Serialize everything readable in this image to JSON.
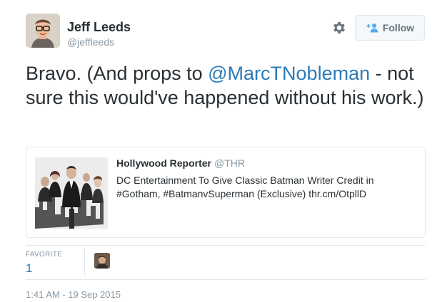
{
  "author": {
    "name": "Jeff Leeds",
    "handle": "@jeffleeds"
  },
  "header": {
    "follow_label": "Follow"
  },
  "tweet": {
    "text_part1": "Bravo. (And props to ",
    "mention": "@MarcTNobleman",
    "text_part2": " - not sure this would've happened without his work.)"
  },
  "card": {
    "source_name": "Hollywood Reporter",
    "source_handle": "@THR",
    "text": "DC Entertainment To Give Classic Batman Writer Credit in #Gotham, #BatmanvSuperman (Exclusive) thr.cm/OtpllD"
  },
  "stats": {
    "favorite_label": "FAVORITE",
    "favorite_count": "1"
  },
  "timestamp": "1:41 AM - 19 Sep 2015",
  "colors": {
    "link": "#2b7bb9",
    "muted": "#8899a6",
    "text": "#292f33",
    "border": "#e1e8ed"
  },
  "icons": {
    "settings": "gear-icon",
    "follow": "add-user-icon"
  }
}
